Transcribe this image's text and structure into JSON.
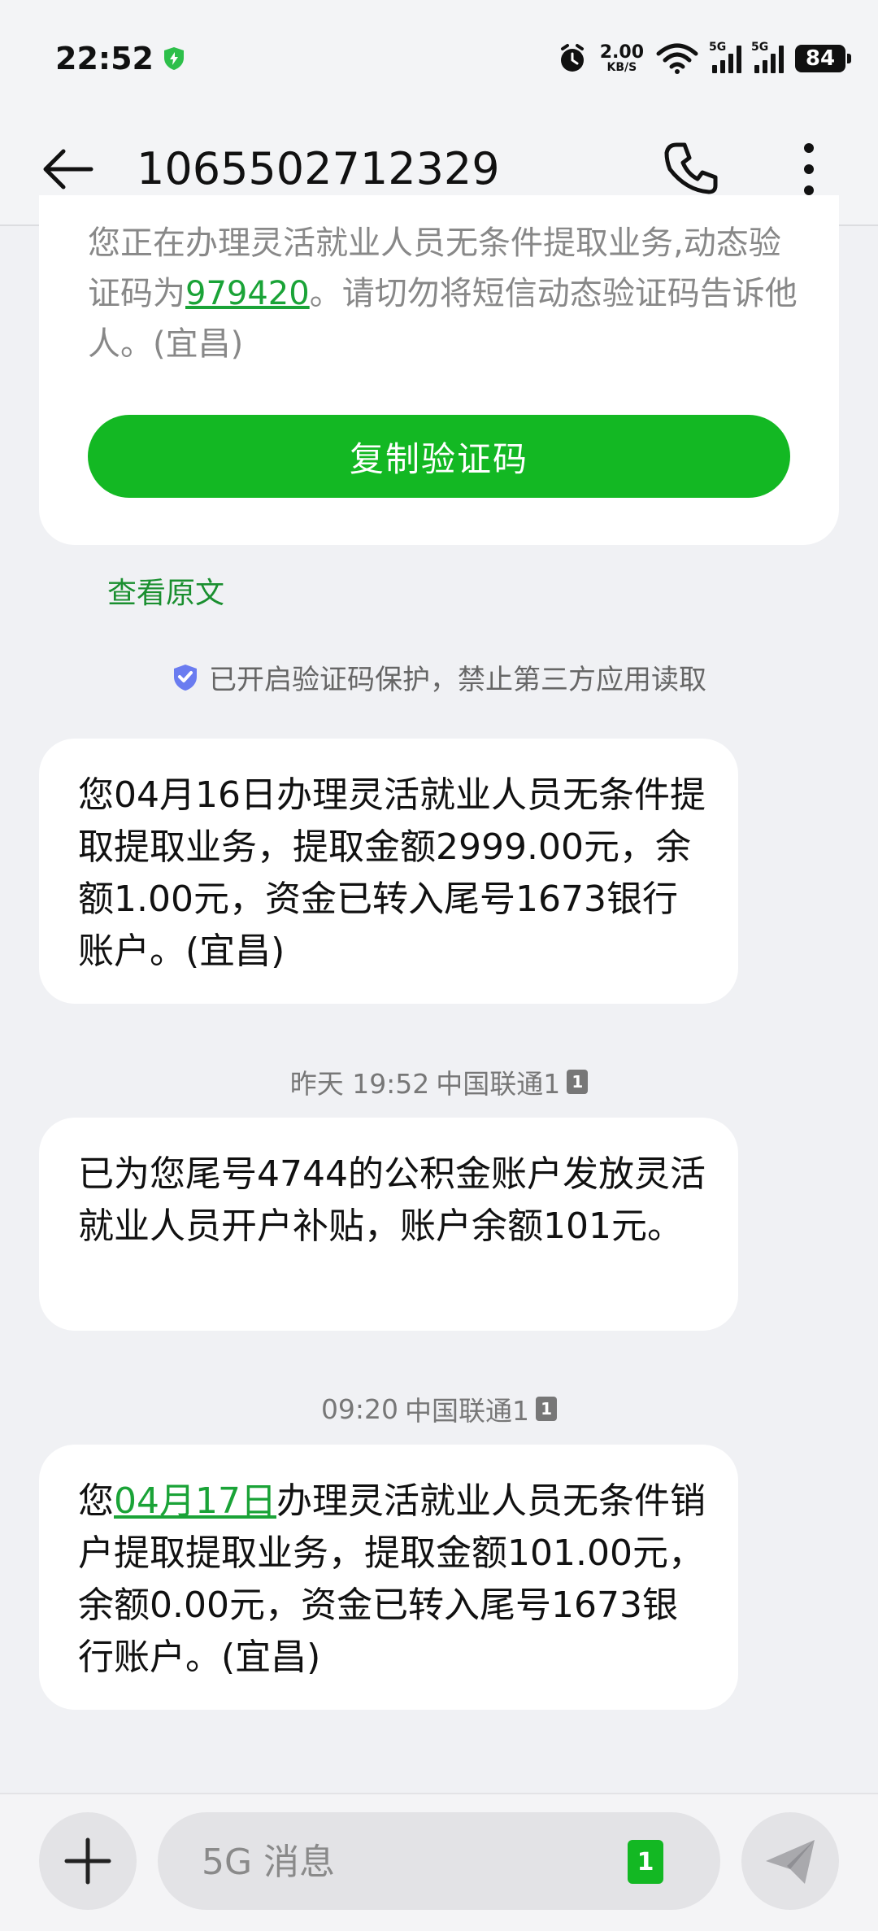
{
  "status": {
    "time": "22:52",
    "speed_value": "2.00",
    "speed_unit": "KB/S",
    "sim1_label": "5G",
    "sim2_label": "5G",
    "battery": "84"
  },
  "header": {
    "contact": "1065502712329"
  },
  "code_message": {
    "text_before": "您正在办理灵活就业人员无条件提取业务,动态验证码为",
    "code": "979420",
    "text_after": "。请切勿将短信动态验证码告诉他人。(宜昌)",
    "copy_button": "复制验证码"
  },
  "view_original": "查看原文",
  "protection_notice": "已开启验证码保护，禁止第三方应用读取",
  "messages": [
    {
      "text": "您04月16日办理灵活就业人员无条件提取提取业务，提取金额2999.00元，余额1.00元，资金已转入尾号1673银行账户。(宜昌)"
    },
    {
      "timestamp": "昨天 19:52",
      "carrier": "中国联通1",
      "sim_badge": "1",
      "text": "已为您尾号4744的公积金账户发放灵活就业人员开户补贴，账户余额101元。"
    },
    {
      "timestamp": "09:20",
      "carrier": "中国联通1",
      "sim_badge": "1",
      "text_prefix": "您",
      "date_link": "04月17日",
      "text_rest": "办理灵活就业人员无条件销户提取提取业务，提取金额101.00元，余额0.00元，资金已转入尾号1673银行账户。(宜昌)"
    }
  ],
  "composer": {
    "placeholder": "5G 消息",
    "sim_selector": "1"
  },
  "colors": {
    "accent_green": "#13b823",
    "link_green": "#1aa337",
    "background": "#f0f1f4"
  }
}
